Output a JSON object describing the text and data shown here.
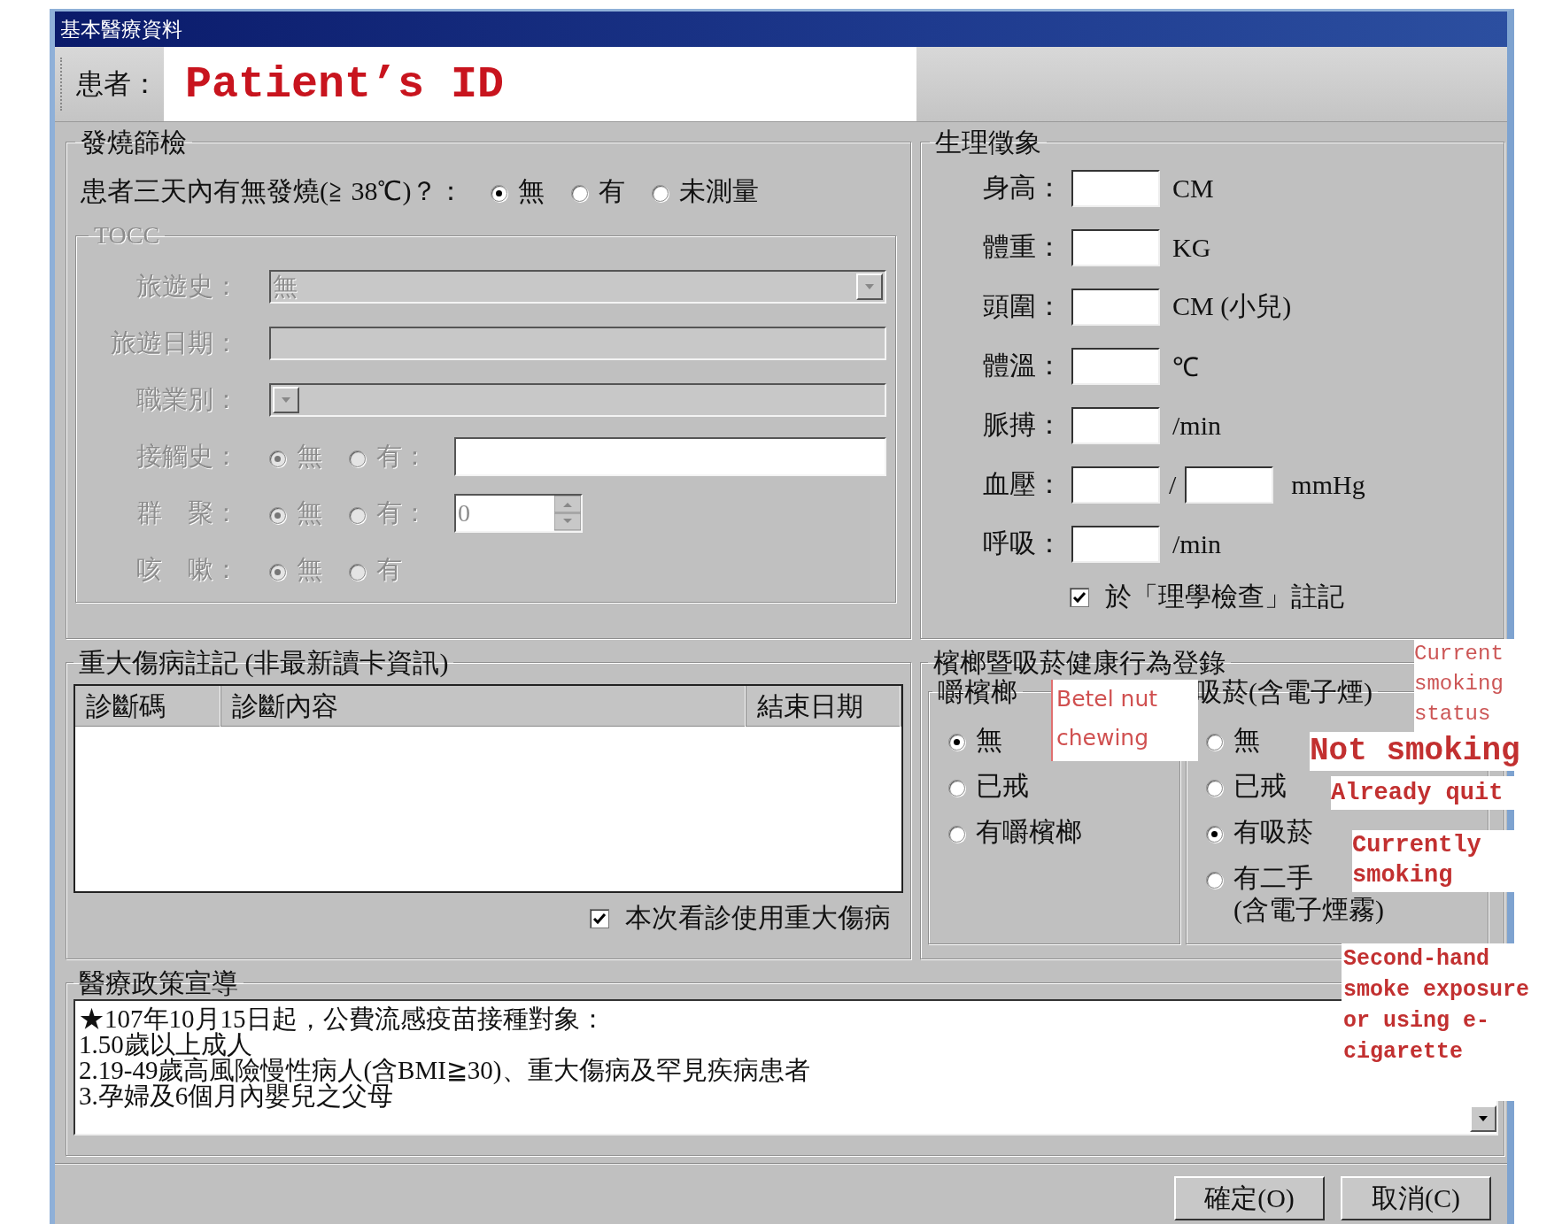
{
  "window": {
    "title": "基本醫療資料"
  },
  "patient": {
    "label": "患者：",
    "value": "Patient’s ID"
  },
  "fever_screening": {
    "title": "發燒篩檢",
    "question": "患者三天內有無發燒(≧ 38℃)？：",
    "options": [
      {
        "label": "無",
        "selected": true
      },
      {
        "label": "有",
        "selected": false
      },
      {
        "label": "未測量",
        "selected": false
      }
    ],
    "tocc": {
      "title": "TOCC",
      "disabled": true,
      "rows": [
        {
          "kind": "dropdown",
          "label": "旅遊史：",
          "value": "無"
        },
        {
          "kind": "text",
          "label": "旅遊日期："
        },
        {
          "kind": "dropdown",
          "label": "職業別："
        },
        {
          "kind": "radio_text",
          "label": "接觸史：",
          "options": [
            {
              "label": "無",
              "selected": true
            },
            {
              "label": "有：",
              "selected": false
            }
          ]
        },
        {
          "kind": "radio_spin",
          "label": "群　聚：",
          "value": "0",
          "options": [
            {
              "label": "無",
              "selected": true
            },
            {
              "label": "有：",
              "selected": false
            }
          ]
        },
        {
          "kind": "radio",
          "label": "咳　嗽：",
          "options": [
            {
              "label": "無",
              "selected": true
            },
            {
              "label": "有",
              "selected": false
            }
          ]
        }
      ]
    }
  },
  "vital_signs": {
    "title": "生理徵象",
    "rows": [
      {
        "kind": "single",
        "label": "身高：",
        "unit": "CM"
      },
      {
        "kind": "single",
        "label": "體重：",
        "unit": "KG"
      },
      {
        "kind": "single",
        "label": "頭圍：",
        "unit": "CM (小兒)"
      },
      {
        "kind": "single",
        "label": "體溫：",
        "unit": "℃"
      },
      {
        "kind": "single",
        "label": "脈搏：",
        "unit": "/min"
      },
      {
        "kind": "pair",
        "label": "血壓：",
        "separator": "/",
        "unit": "mmHg"
      },
      {
        "kind": "single",
        "label": "呼吸：",
        "unit": "/min"
      }
    ],
    "checkbox": {
      "label": "於「理學檢查」註記",
      "checked": true
    }
  },
  "catastrophic_illness": {
    "title": "重大傷病註記 (非最新讀卡資訊)",
    "columns": [
      "診斷碼",
      "診斷內容",
      "結束日期"
    ],
    "checkbox": {
      "label": "本次看診使用重大傷病",
      "checked": true
    }
  },
  "habits": {
    "title": "檳榔暨吸菸健康行為登錄",
    "betel": {
      "title": "嚼檳榔",
      "options": [
        {
          "label": "無",
          "selected": true
        },
        {
          "label": "已戒",
          "selected": false
        },
        {
          "label": "有嚼檳榔",
          "selected": false
        }
      ]
    },
    "smoking": {
      "title": "吸菸(含電子煙)",
      "options": [
        {
          "label": "無",
          "selected": false
        },
        {
          "label": "已戒",
          "selected": false
        },
        {
          "label": "有吸菸",
          "selected": true
        },
        {
          "label": "有二手",
          "line2": "(含電子煙霧)",
          "selected": false
        }
      ]
    }
  },
  "policy": {
    "title": "醫療政策宣導",
    "lines": [
      "★107年10月15日起，公費流感疫苗接種對象：",
      "1.50歲以上成人",
      "2.19-49歲高風險慢性病人(含BMI≧30)、重大傷病及罕見疾病患者",
      "3.孕婦及6個月內嬰兒之父母"
    ]
  },
  "buttons": [
    "確定(O)",
    "取消(C)"
  ],
  "annotations": [
    {
      "kind": "sans",
      "text": "Betel nut chewing"
    },
    {
      "kind": "plain",
      "text": "Current smoking status"
    },
    {
      "kind": "bold",
      "text": "Not smoking"
    },
    {
      "kind": "bold",
      "text": "Already quit"
    },
    {
      "kind": "bold",
      "text": "Currently smoking"
    },
    {
      "kind": "bold",
      "text": "Second-hand smoke exposure or using e-cigarette"
    }
  ]
}
